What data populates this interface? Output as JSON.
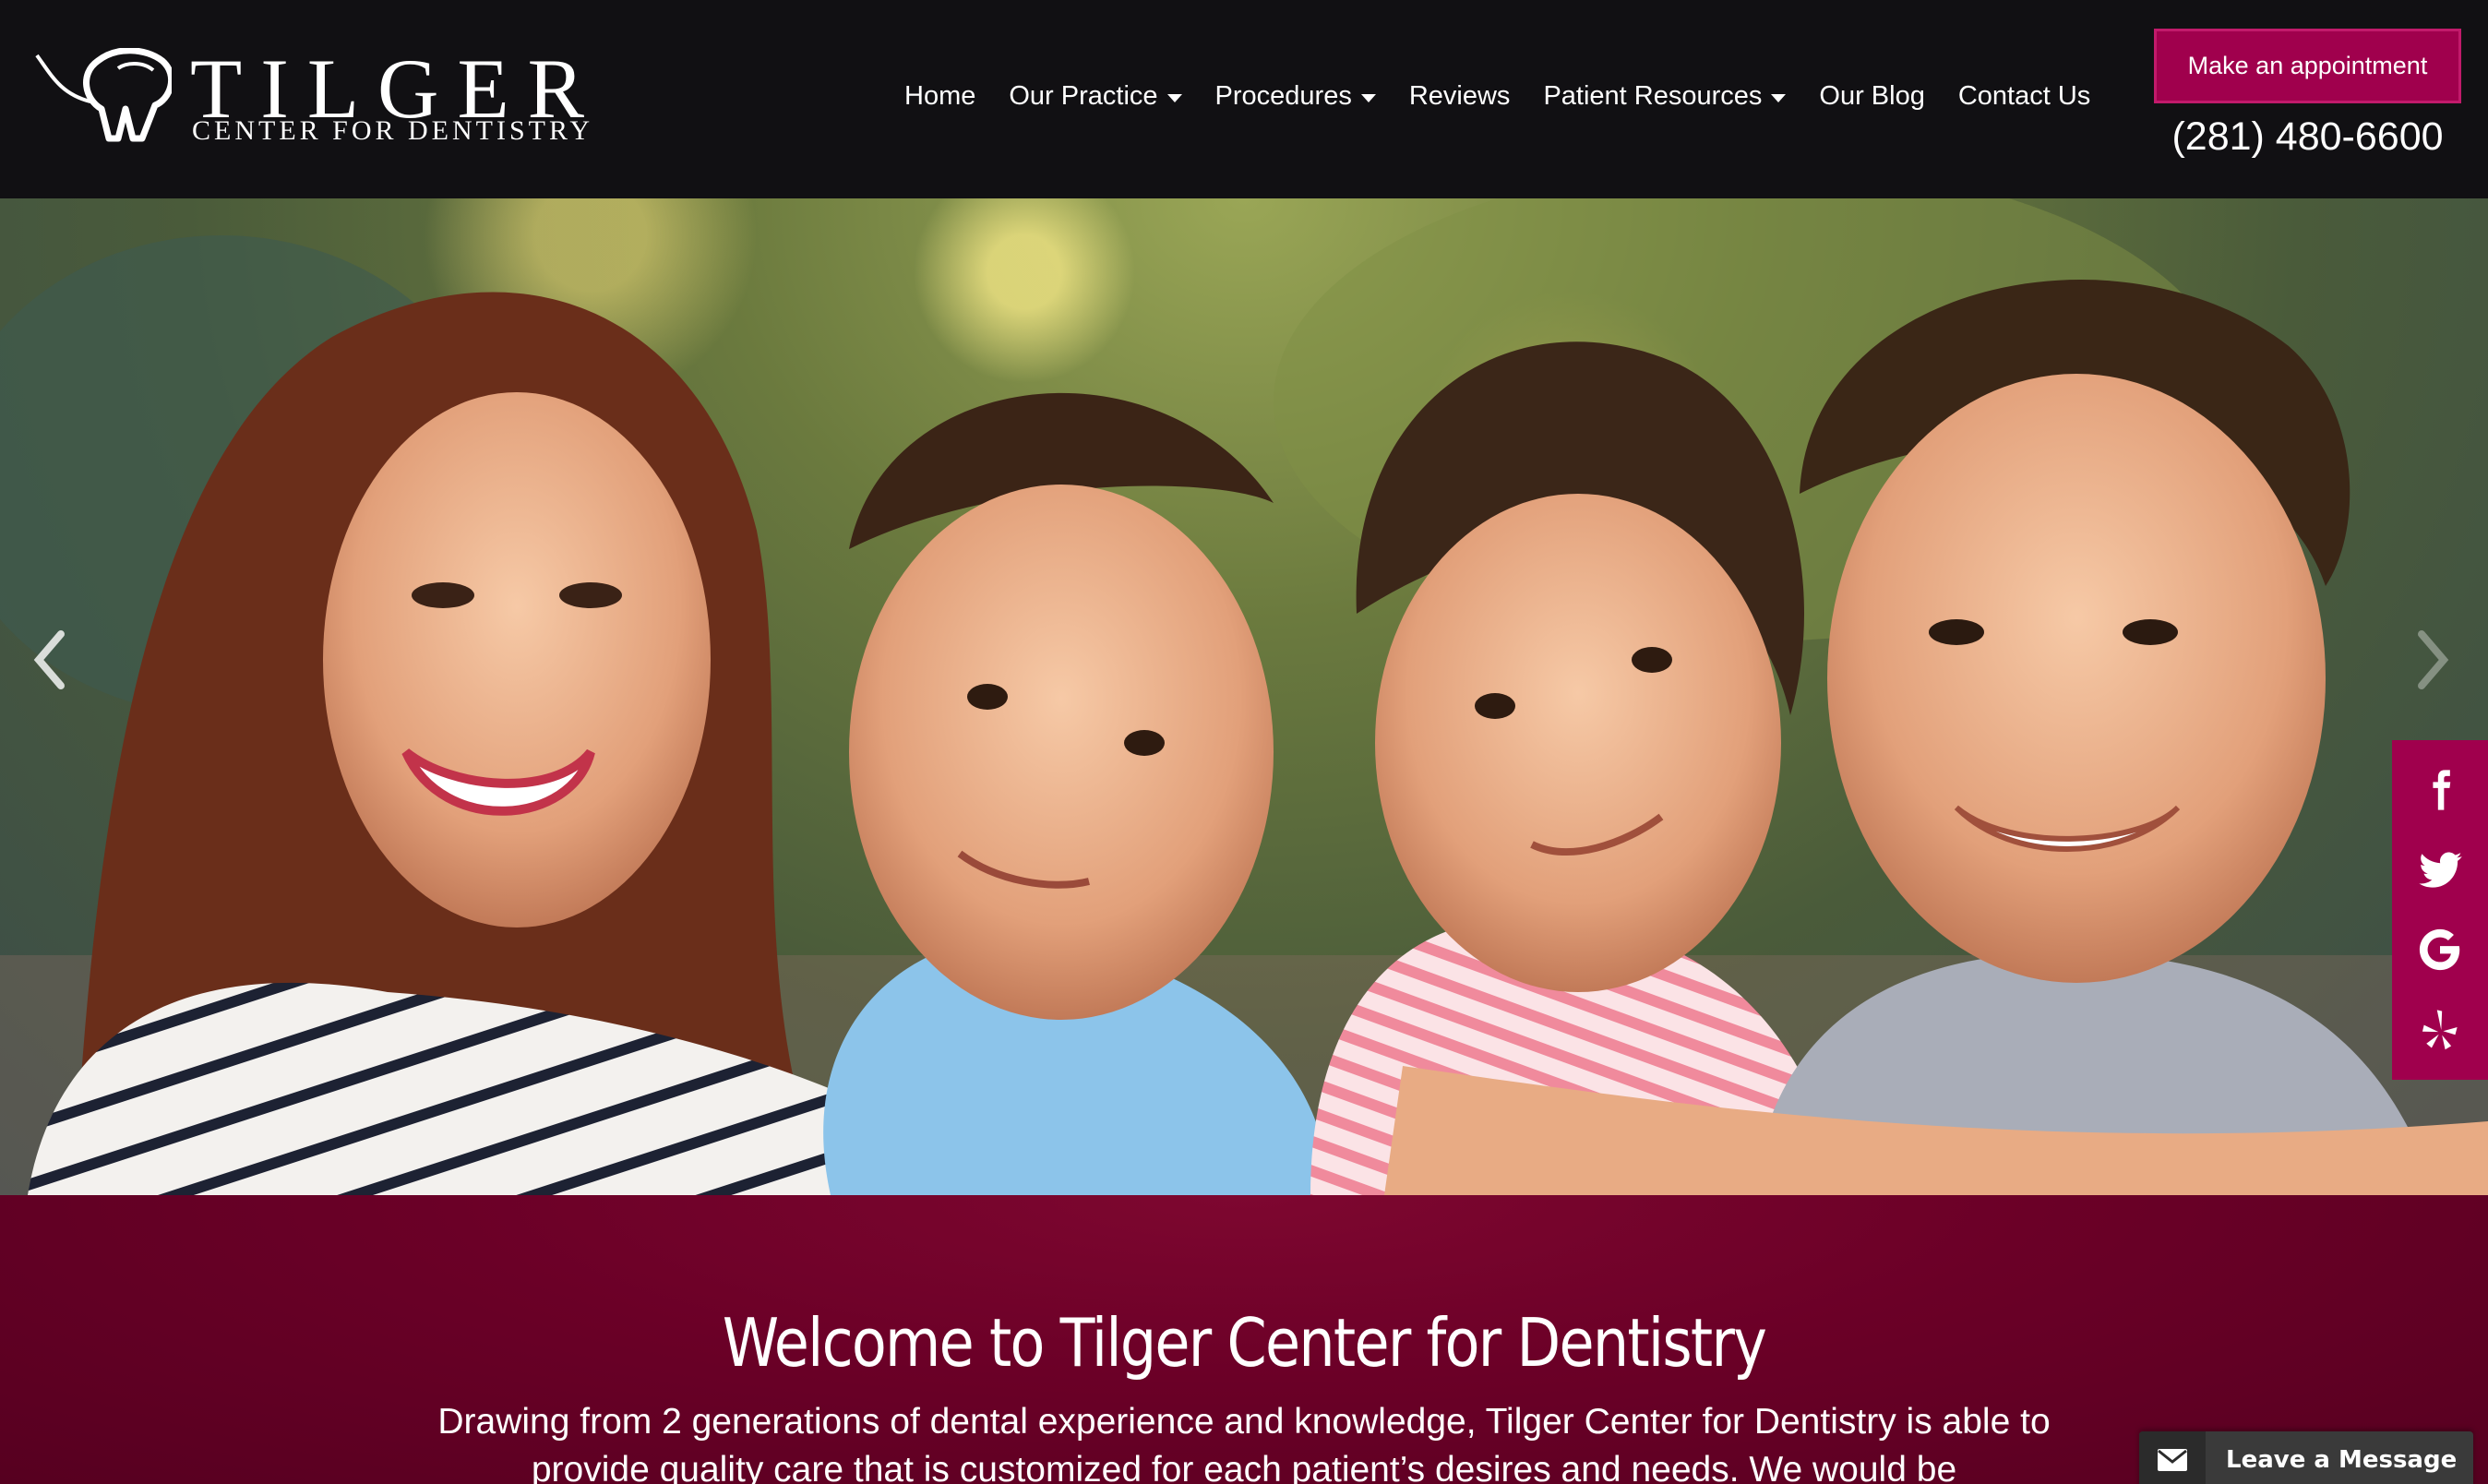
{
  "brand": {
    "name": "TILGER",
    "tagline": "CENTER FOR DENTISTRY",
    "logo_icon": "tooth-heart-icon"
  },
  "nav": {
    "items": [
      {
        "label": "Home",
        "dropdown": false
      },
      {
        "label": "Our Practice",
        "dropdown": true
      },
      {
        "label": "Procedures",
        "dropdown": true
      },
      {
        "label": "Reviews",
        "dropdown": false
      },
      {
        "label": "Patient Resources",
        "dropdown": true
      },
      {
        "label": "Our Blog",
        "dropdown": false
      },
      {
        "label": "Contact Us",
        "dropdown": false
      }
    ]
  },
  "header": {
    "appointment_label": "Make an appointment",
    "phone": "(281) 480-6600"
  },
  "hero": {
    "image": "family-smiling-photo",
    "prev_icon": "chevron-left-icon",
    "next_icon": "chevron-right-icon"
  },
  "social": {
    "icons": [
      "facebook-icon",
      "twitter-icon",
      "google-icon",
      "yelp-icon"
    ]
  },
  "welcome": {
    "title": "Welcome to Tilger Center for Dentistry",
    "text": "Drawing from 2 generations of dental experience and knowledge, Tilger Center for Dentistry is able to provide quality care that is customized for each patient’s desires and needs. We would be"
  },
  "chat": {
    "label": "Leave a Message",
    "icon": "mail-icon"
  },
  "colors": {
    "header_bg": "#111013",
    "accent": "#a0004d",
    "welcome_bg": "#6b0027"
  }
}
